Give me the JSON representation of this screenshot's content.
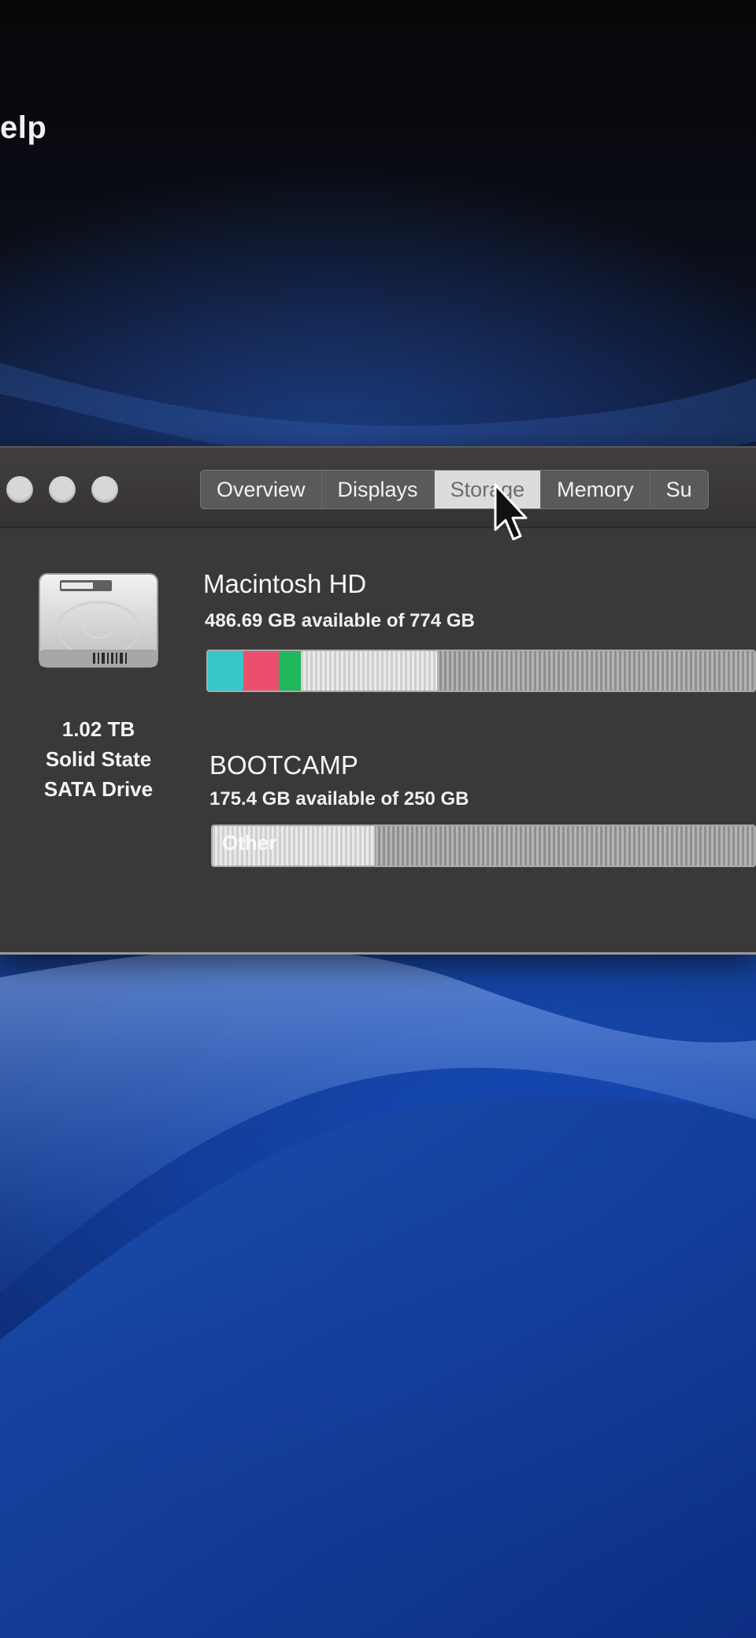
{
  "menu_bar": {
    "visible_item": "elp"
  },
  "window": {
    "tabs": [
      {
        "label": "Overview",
        "selected": false
      },
      {
        "label": "Displays",
        "selected": false
      },
      {
        "label": "Storage",
        "selected": true
      },
      {
        "label": "Memory",
        "selected": false
      },
      {
        "label": "Su",
        "selected": false
      }
    ]
  },
  "drive": {
    "icon": "hard-drive-icon",
    "capacity": "1.02 TB",
    "type_line1": "Solid State",
    "type_line2": "SATA Drive"
  },
  "volumes": [
    {
      "name": "Macintosh HD",
      "availability": "486.69 GB available of 774 GB",
      "segments": [
        {
          "kind": "apps",
          "fraction": 0.065,
          "color": "#38c6c8"
        },
        {
          "kind": "documents",
          "fraction": 0.065,
          "color": "#ec4e6e"
        },
        {
          "kind": "photos",
          "fraction": 0.04,
          "color": "#1fb85a"
        },
        {
          "kind": "other",
          "fraction": 0.25,
          "color": "#dcdcdc"
        }
      ]
    },
    {
      "name": "BOOTCAMP",
      "availability": "175.4 GB available of 250 GB",
      "segments": [
        {
          "kind": "other",
          "label": "Other",
          "fraction": 0.3,
          "color": "#dcdcdc"
        }
      ]
    }
  ],
  "colors": {
    "window_bg": "#3a3838",
    "selected_tab": "#dcdcdc"
  }
}
